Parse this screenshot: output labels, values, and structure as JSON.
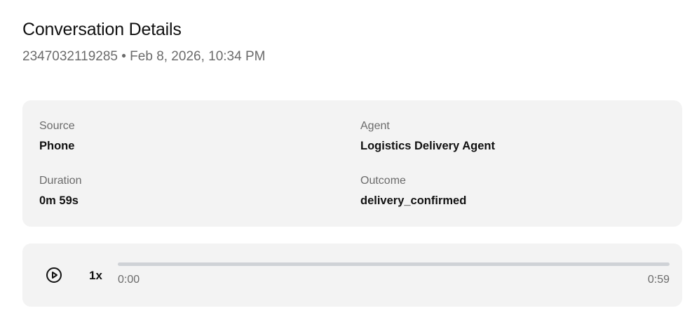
{
  "header": {
    "title": "Conversation Details",
    "subtitle": "2347032119285 • Feb 8, 2026, 10:34 PM"
  },
  "details": {
    "source_label": "Source",
    "source_value": "Phone",
    "agent_label": "Agent",
    "agent_value": "Logistics Delivery Agent",
    "duration_label": "Duration",
    "duration_value": "0m 59s",
    "outcome_label": "Outcome",
    "outcome_value": "delivery_confirmed"
  },
  "player": {
    "play_icon": "play-circle-icon",
    "speed": "1x",
    "current_time": "0:00",
    "total_time": "0:59",
    "progress": 0
  }
}
